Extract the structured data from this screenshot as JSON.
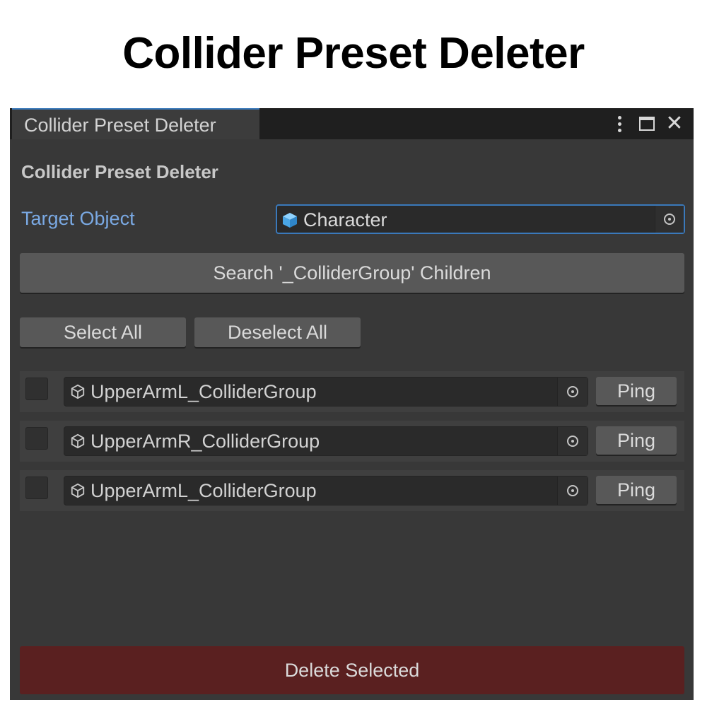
{
  "banner": {
    "title": "Collider Preset Deleter"
  },
  "window": {
    "tab_title": "Collider Preset Deleter",
    "icons": [
      "more-vert-icon",
      "maximize-icon",
      "close-icon"
    ],
    "close_glyph": "✕"
  },
  "panel": {
    "heading": "Collider Preset Deleter",
    "target_label": "Target Object",
    "target_value": "Character",
    "search_button": "Search '_ColliderGroup' Children",
    "select_all": "Select All",
    "deselect_all": "Deselect All",
    "delete_button": "Delete Selected"
  },
  "results": [
    {
      "name": "UpperArmL_ColliderGroup",
      "ping": "Ping",
      "checked": false
    },
    {
      "name": "UpperArmR_ColliderGroup",
      "ping": "Ping",
      "checked": false
    },
    {
      "name": "UpperArmL_ColliderGroup",
      "ping": "Ping",
      "checked": false
    }
  ],
  "colors": {
    "accent": "#3a79bb",
    "label_blue": "#7aa9e3",
    "delete_bg": "#5a2020",
    "panel_bg": "#383838",
    "cube_blue": "#5fb6ef"
  }
}
